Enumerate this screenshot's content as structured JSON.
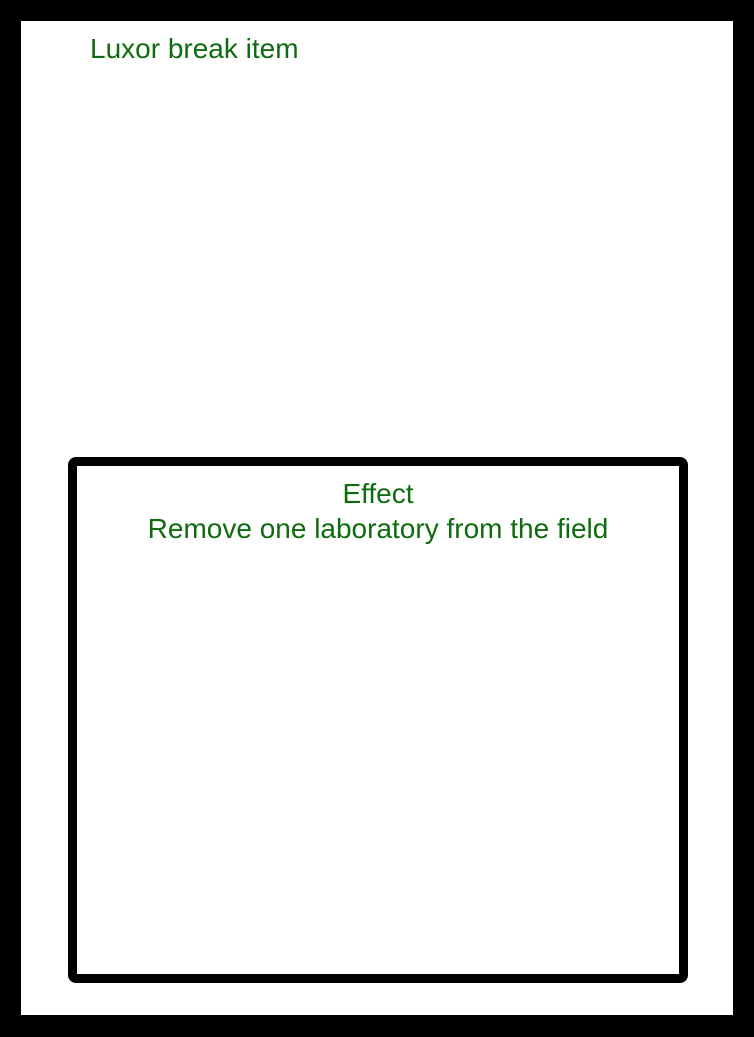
{
  "card": {
    "title": "Luxor break item",
    "effect_heading": "Effect",
    "effect_text": "Remove one laboratory from the field"
  },
  "colors": {
    "border": "#000000",
    "background": "#ffffff",
    "text": "#0f6b0f"
  }
}
